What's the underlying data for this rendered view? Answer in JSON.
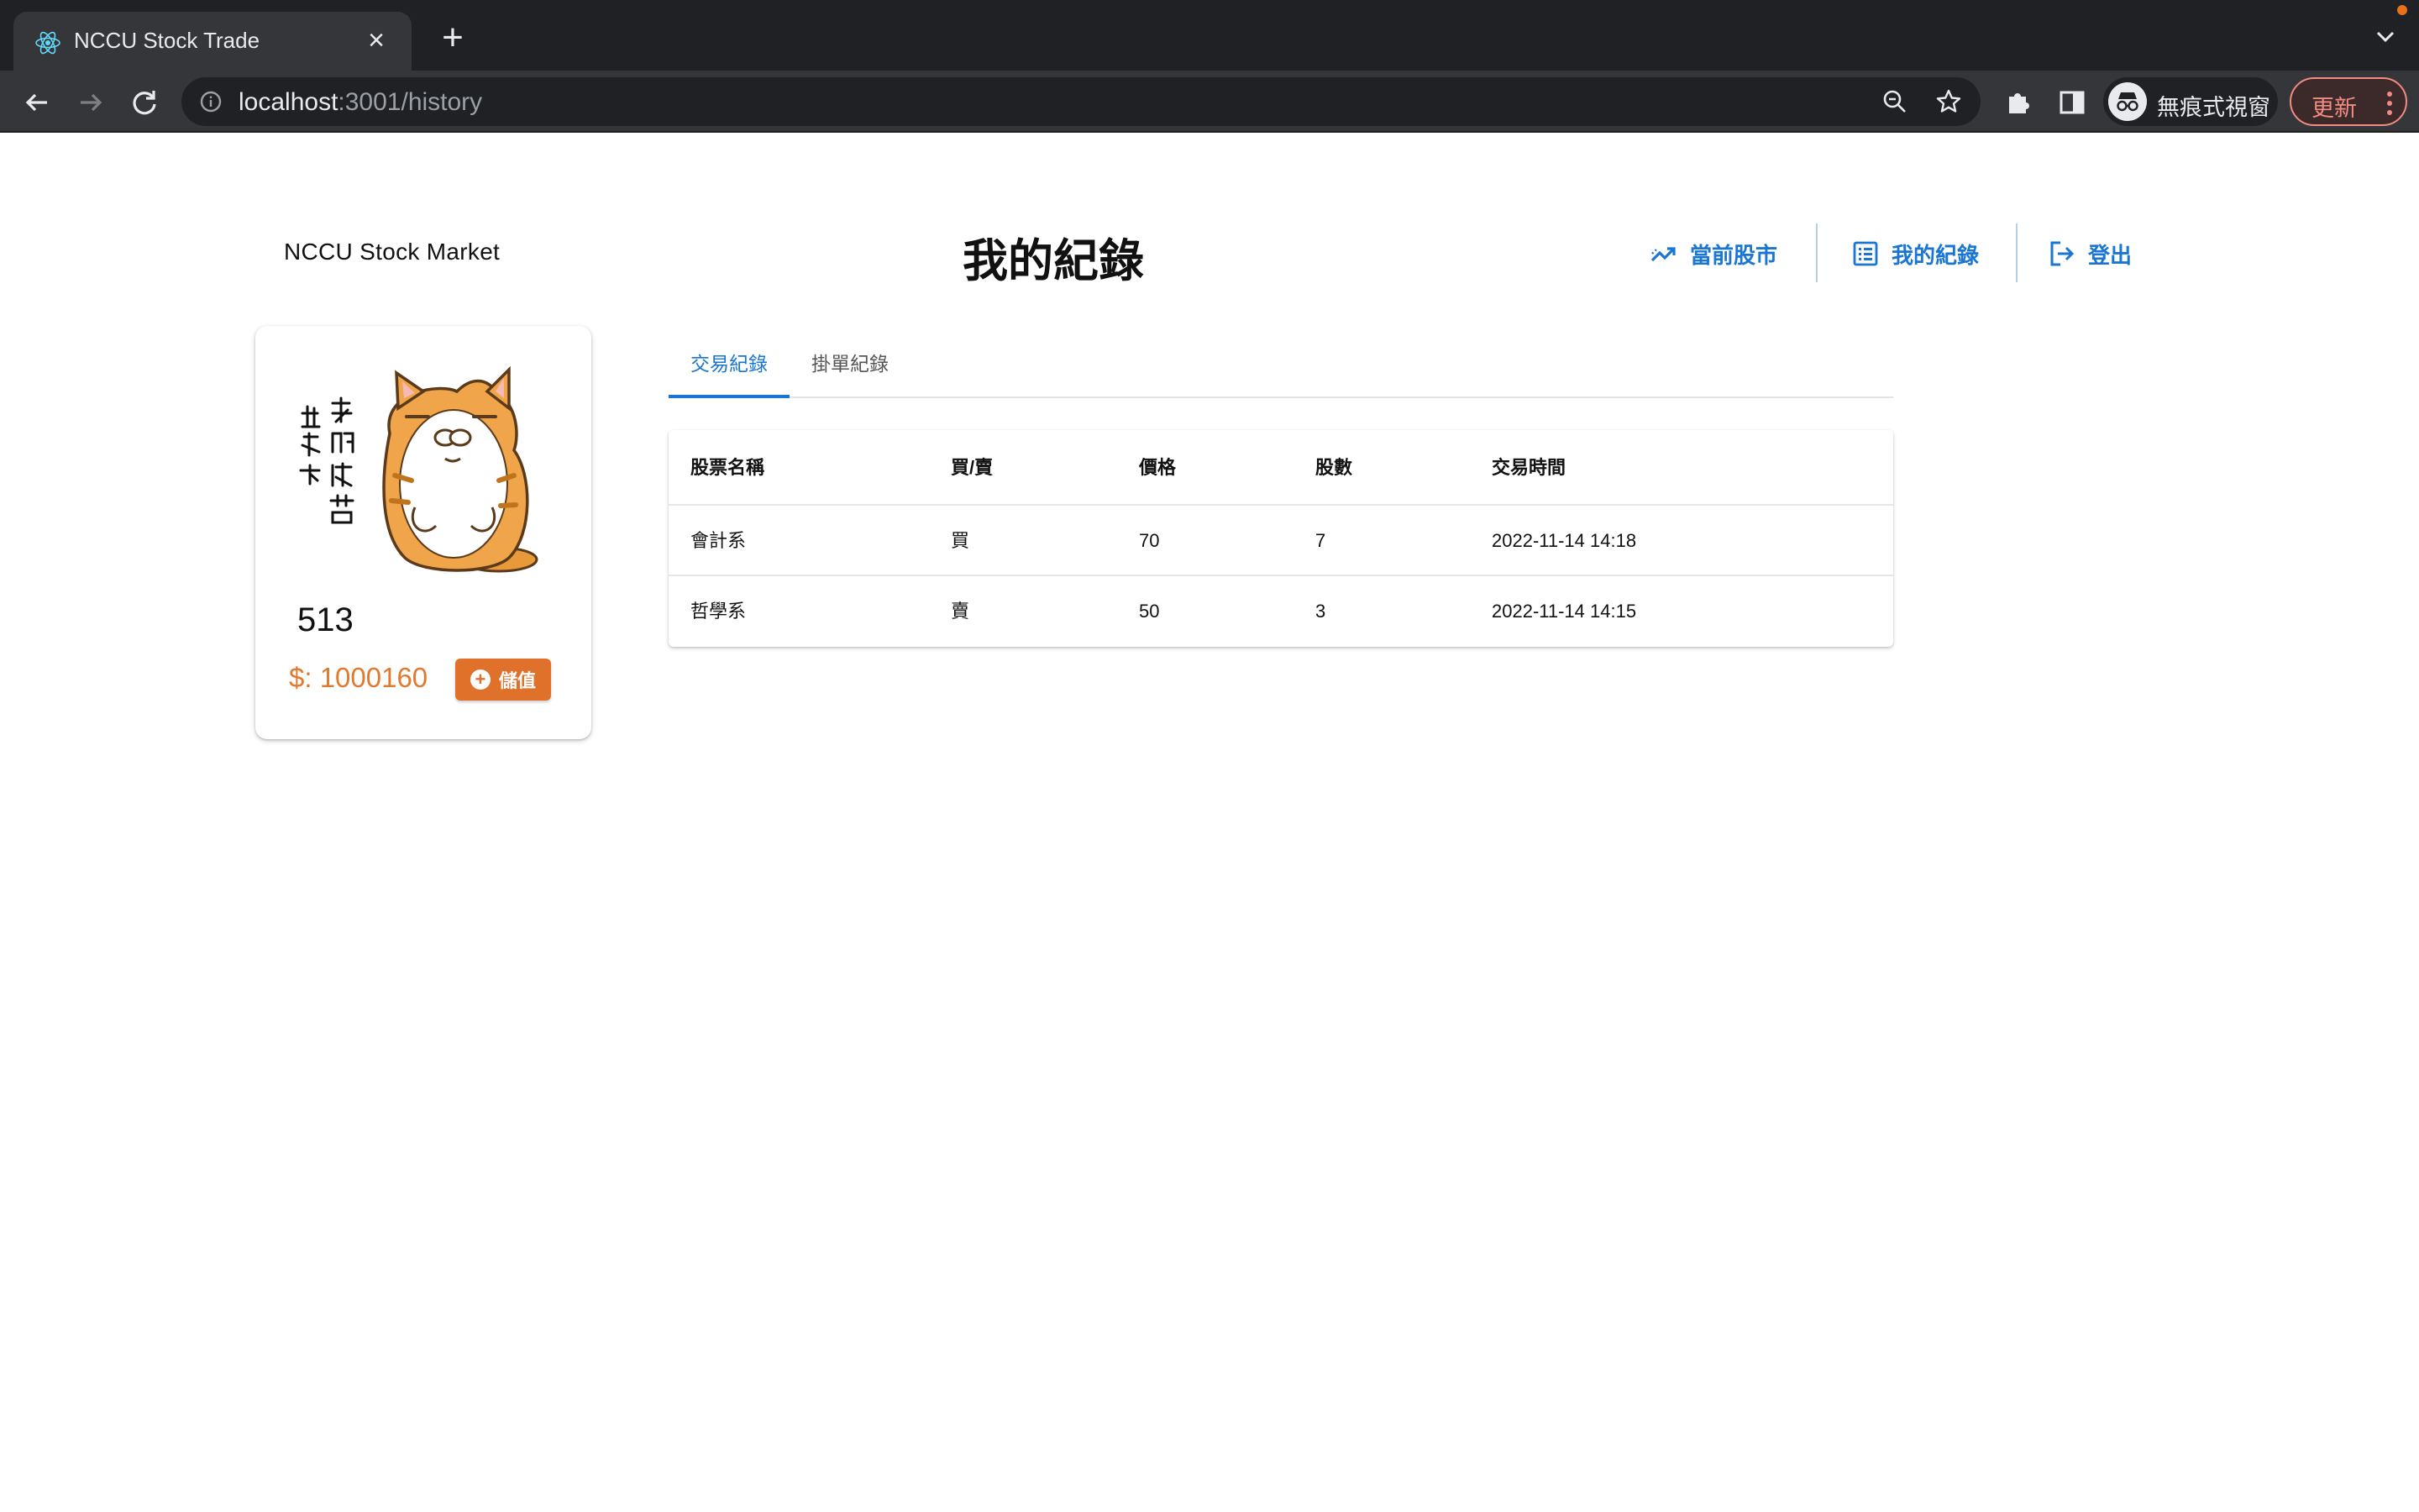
{
  "browser": {
    "tab_title": "NCCU Stock Trade",
    "url_host": "localhost",
    "url_rest": ":3001/history",
    "profile_label": "無痕式視窗",
    "update_label": "更新"
  },
  "header": {
    "brand": "NCCU Stock Market",
    "title": "我的紀錄",
    "nav": [
      {
        "label": "當前股市",
        "icon": "trending-up-icon"
      },
      {
        "label": "我的紀錄",
        "icon": "list-icon"
      },
      {
        "label": "登出",
        "icon": "logout-icon"
      }
    ]
  },
  "profile": {
    "user_id": "513",
    "balance": "$: 1000160",
    "deposit_label": "儲值",
    "avatar_text": "請收下我的膝蓋"
  },
  "tabs": [
    {
      "label": "交易紀錄",
      "active": true
    },
    {
      "label": "掛單紀錄",
      "active": false
    }
  ],
  "table": {
    "columns": [
      "股票名稱",
      "買/賣",
      "價格",
      "股數",
      "交易時間"
    ],
    "rows": [
      [
        "會計系",
        "買",
        "70",
        "7",
        "2022-11-14 14:18"
      ],
      [
        "哲學系",
        "賣",
        "50",
        "3",
        "2022-11-14 14:15"
      ]
    ]
  },
  "colors": {
    "accent": "#1976d2",
    "balance": "#e07a2e",
    "deposit_button": "#e0712a"
  }
}
